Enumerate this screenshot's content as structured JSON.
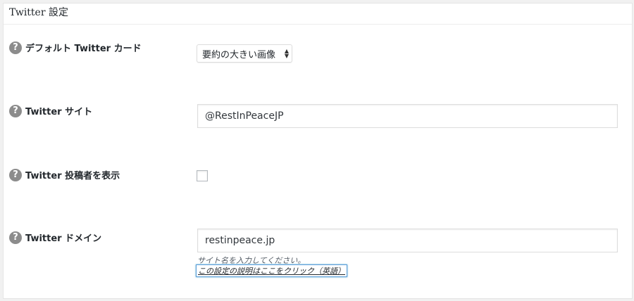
{
  "section": {
    "title": "Twitter 設定"
  },
  "fields": {
    "default_card": {
      "label": "デフォルト Twitter カード",
      "selected_option": "要約の大きい画像"
    },
    "site": {
      "label": "Twitter サイト",
      "value": "@RestInPeaceJP"
    },
    "show_author": {
      "label": "Twitter 投稿者を表示",
      "checked": false
    },
    "domain": {
      "label": "Twitter ドメイン",
      "value": "restinpeace.jp",
      "description": "サイト名を入力してください。",
      "help_link": "この設定の説明はここをクリック（英語）"
    }
  },
  "help_icon_glyph": "?",
  "colors": {
    "help_icon": "#8c8c8c",
    "focus_border": "#5b9dd9"
  }
}
